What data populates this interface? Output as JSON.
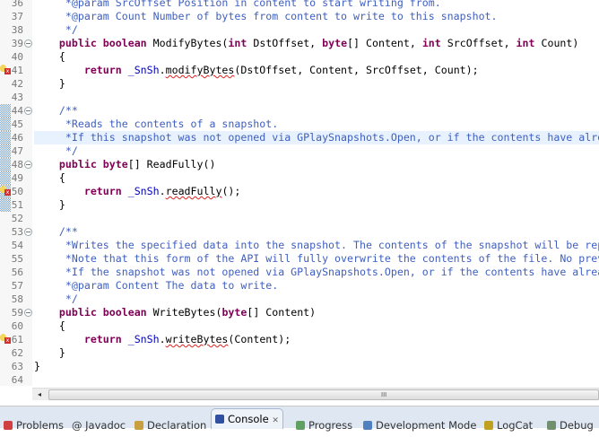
{
  "editor": {
    "lines": [
      {
        "n": "36",
        "tokens": [
          {
            "t": "     *@param SrcOffset Position in content to start writing from.",
            "c": "cm"
          }
        ]
      },
      {
        "n": "37",
        "tokens": [
          {
            "t": "     *@param Count Number of bytes from content to write to this snapshot.",
            "c": "cm"
          }
        ]
      },
      {
        "n": "38",
        "tokens": [
          {
            "t": "     */",
            "c": "cm"
          }
        ]
      },
      {
        "n": "39",
        "fold": true,
        "tokens": [
          {
            "t": "    "
          },
          {
            "t": "public",
            "c": "kw"
          },
          {
            "t": " "
          },
          {
            "t": "boolean",
            "c": "kw"
          },
          {
            "t": " ModifyBytes("
          },
          {
            "t": "int",
            "c": "kw"
          },
          {
            "t": " DstOffset, "
          },
          {
            "t": "byte",
            "c": "kw"
          },
          {
            "t": "[] Content, "
          },
          {
            "t": "int",
            "c": "kw"
          },
          {
            "t": " SrcOffset, "
          },
          {
            "t": "int",
            "c": "kw"
          },
          {
            "t": " Count)"
          }
        ]
      },
      {
        "n": "40",
        "tokens": [
          {
            "t": "    {"
          }
        ]
      },
      {
        "n": "41",
        "marker": true,
        "tokens": [
          {
            "t": "        "
          },
          {
            "t": "return",
            "c": "kw"
          },
          {
            "t": " "
          },
          {
            "t": "_SnSh",
            "c": "fld"
          },
          {
            "t": "."
          },
          {
            "t": "modifyBytes",
            "c": "er"
          },
          {
            "t": "(DstOffset, Content, SrcOffset, Count);"
          }
        ]
      },
      {
        "n": "42",
        "tokens": [
          {
            "t": "    }"
          }
        ]
      },
      {
        "n": "43",
        "tokens": []
      },
      {
        "n": "44",
        "fold": true,
        "chk": true,
        "tokens": [
          {
            "t": "    /**",
            "c": "cm"
          }
        ]
      },
      {
        "n": "45",
        "chk": true,
        "tokens": [
          {
            "t": "     *Reads the contents of a snapshot.",
            "c": "cm"
          }
        ]
      },
      {
        "n": "46",
        "chk": true,
        "hl": true,
        "tokens": [
          {
            "t": "     *If this snapshot was not opened via GPlaySnapshots.Open, or if the contents have already been",
            "c": "cm"
          }
        ]
      },
      {
        "n": "47",
        "chk": true,
        "tokens": [
          {
            "t": "     */",
            "c": "cm"
          }
        ]
      },
      {
        "n": "48",
        "fold": true,
        "chk": true,
        "tokens": [
          {
            "t": "    "
          },
          {
            "t": "public",
            "c": "kw"
          },
          {
            "t": " "
          },
          {
            "t": "byte",
            "c": "kw"
          },
          {
            "t": "[] ReadFully()"
          }
        ]
      },
      {
        "n": "49",
        "chk": true,
        "tokens": [
          {
            "t": "    {"
          }
        ]
      },
      {
        "n": "50",
        "chk": true,
        "marker": true,
        "tokens": [
          {
            "t": "        "
          },
          {
            "t": "return",
            "c": "kw"
          },
          {
            "t": " "
          },
          {
            "t": "_SnSh",
            "c": "fld"
          },
          {
            "t": "."
          },
          {
            "t": "readFully",
            "c": "er"
          },
          {
            "t": "();"
          }
        ]
      },
      {
        "n": "51",
        "chk": true,
        "tokens": [
          {
            "t": "    }"
          }
        ]
      },
      {
        "n": "52",
        "tokens": []
      },
      {
        "n": "53",
        "fold": true,
        "tokens": [
          {
            "t": "    /**",
            "c": "cm"
          }
        ]
      },
      {
        "n": "54",
        "tokens": [
          {
            "t": "     *Writes the specified data into the snapshot. The contents of the snapshot will be replaced",
            "c": "cm"
          }
        ]
      },
      {
        "n": "55",
        "tokens": [
          {
            "t": "     *Note that this form of the API will fully overwrite the contents of the file. No previous",
            "c": "cm"
          }
        ]
      },
      {
        "n": "56",
        "tokens": [
          {
            "t": "     *If the snapshot was not opened via GPlaySnapshots.Open, or if the contents have already",
            "c": "cm"
          }
        ]
      },
      {
        "n": "57",
        "tokens": [
          {
            "t": "     *@param Content The data to write.",
            "c": "cm"
          }
        ]
      },
      {
        "n": "58",
        "tokens": [
          {
            "t": "     */",
            "c": "cm"
          }
        ]
      },
      {
        "n": "59",
        "fold": true,
        "tokens": [
          {
            "t": "    "
          },
          {
            "t": "public",
            "c": "kw"
          },
          {
            "t": " "
          },
          {
            "t": "boolean",
            "c": "kw"
          },
          {
            "t": " WriteBytes("
          },
          {
            "t": "byte",
            "c": "kw"
          },
          {
            "t": "[] Content)"
          }
        ]
      },
      {
        "n": "60",
        "tokens": [
          {
            "t": "    {"
          }
        ]
      },
      {
        "n": "61",
        "marker": true,
        "tokens": [
          {
            "t": "        "
          },
          {
            "t": "return",
            "c": "kw"
          },
          {
            "t": " "
          },
          {
            "t": "_SnSh",
            "c": "fld"
          },
          {
            "t": "."
          },
          {
            "t": "writeBytes",
            "c": "er"
          },
          {
            "t": "(Content);"
          }
        ]
      },
      {
        "n": "62",
        "tokens": [
          {
            "t": "    }"
          }
        ]
      },
      {
        "n": "63",
        "tokens": [
          {
            "t": "}"
          }
        ]
      },
      {
        "n": "64",
        "tokens": []
      }
    ]
  },
  "scrollbar": {
    "left_arrow": "◂",
    "grip": "III"
  },
  "tabs": [
    {
      "label": "Problems",
      "icon": "problems-icon",
      "color": "#d04040"
    },
    {
      "label": "@ Javadoc",
      "icon": "javadoc-icon",
      "color": ""
    },
    {
      "label": "Declaration",
      "icon": "declaration-icon",
      "color": "#c8a040"
    },
    {
      "label": "Console",
      "icon": "console-icon",
      "color": "#3050a0",
      "active": true,
      "close": "✕"
    },
    {
      "label": "Progress",
      "icon": "progress-icon",
      "color": "#60a060"
    },
    {
      "label": "Development Mode",
      "icon": "development-mode-icon",
      "color": "#5080c0"
    },
    {
      "label": "LogCat",
      "icon": "logcat-icon",
      "color": "#c0a020"
    },
    {
      "label": "Debug",
      "icon": "debug-icon",
      "color": "#709070"
    }
  ]
}
